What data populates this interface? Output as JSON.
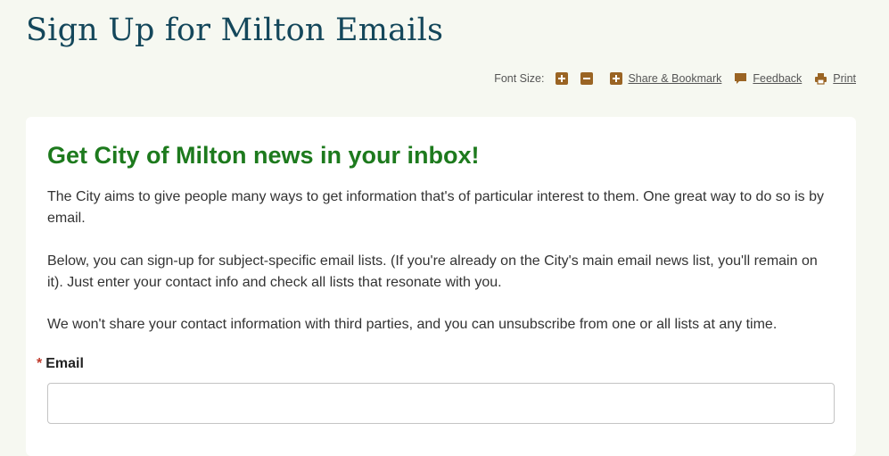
{
  "page": {
    "title": "Sign Up for Milton Emails"
  },
  "toolbar": {
    "font_size_label": "Font Size:",
    "increase_icon": "plus-square-icon",
    "decrease_icon": "minus-square-icon",
    "share_label": "Share & Bookmark",
    "share_icon": "plus-square-icon",
    "feedback_label": "Feedback",
    "feedback_icon": "speech-bubble-icon",
    "print_label": "Print",
    "print_icon": "printer-icon",
    "icon_color": "#9a6424"
  },
  "content": {
    "heading": "Get City of Milton news in your inbox!",
    "paragraphs": [
      "The City aims to give people many ways to get information that's of particular interest to them. One great way to do so is by email.",
      "Below, you can sign-up for subject-specific email lists. (If you're already on the City's main email news list, you'll remain on it). Just enter your contact info and check all lists that resonate with you.",
      "We won't share your contact information with third parties, and you can unsubscribe from one or all lists at any time."
    ]
  },
  "form": {
    "email": {
      "required_marker": "*",
      "label": "Email",
      "value": "",
      "placeholder": ""
    }
  },
  "colors": {
    "title": "#14475b",
    "heading": "#1d7a1d",
    "page_background": "#f6f8f1",
    "required": "#c0392b"
  }
}
